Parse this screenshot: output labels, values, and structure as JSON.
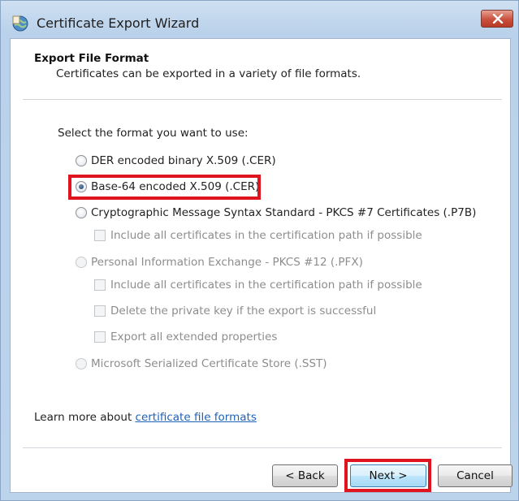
{
  "window": {
    "title": "Certificate Export Wizard"
  },
  "header": {
    "title": "Export File Format",
    "subtitle": "Certificates can be exported in a variety of file formats."
  },
  "prompt": "Select the format you want to use:",
  "options": [
    {
      "label": "DER encoded binary X.509 (.CER)",
      "selected": false,
      "enabled": true
    },
    {
      "label": "Base-64 encoded X.509 (.CER)",
      "selected": true,
      "enabled": true
    },
    {
      "label": "Cryptographic Message Syntax Standard - PKCS #7 Certificates (.P7B)",
      "selected": false,
      "enabled": true
    },
    {
      "label": "Personal Information Exchange - PKCS #12 (.PFX)",
      "selected": false,
      "enabled": false
    },
    {
      "label": "Microsoft Serialized Certificate Store (.SST)",
      "selected": false,
      "enabled": false
    }
  ],
  "p7b_checkbox": {
    "label": "Include all certificates in the certification path if possible",
    "checked": false
  },
  "pfx_checkboxes": [
    {
      "label": "Include all certificates in the certification path if possible",
      "checked": false
    },
    {
      "label": "Delete the private key if the export is successful",
      "checked": false
    },
    {
      "label": "Export all extended properties",
      "checked": false
    }
  ],
  "learn_more": {
    "prefix": "Learn more about ",
    "link": "certificate file formats"
  },
  "buttons": {
    "back": "< Back",
    "next": "Next >",
    "cancel": "Cancel"
  },
  "colors": {
    "highlight": "#e0141e",
    "link": "#1c62b8",
    "frame": "#bcd3ec"
  }
}
